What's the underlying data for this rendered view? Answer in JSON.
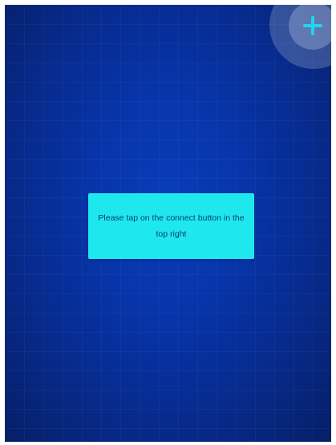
{
  "screen": {
    "background_color": "#0734a8",
    "accent_color": "#1ee8ee"
  },
  "connect_button": {
    "icon": "plus-icon",
    "icon_color": "#1fd6f0"
  },
  "message": {
    "text": "Please tap on the connect button in the top right"
  }
}
